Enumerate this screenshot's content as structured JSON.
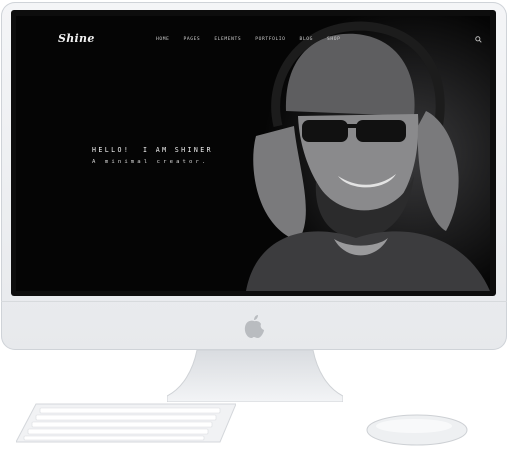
{
  "site": {
    "logo": "Shine",
    "nav": [
      "HOME",
      "PAGES",
      "ELEMENTS",
      "PORTFOLIO",
      "BLOG",
      "SHOP"
    ],
    "hero_title": "HELLO!  I AM SHINER",
    "hero_subtitle": "A minimal creator."
  },
  "icons": {
    "search": "search-icon",
    "apple": "apple-logo-icon"
  },
  "colors": {
    "screen_bg": "#050505",
    "frame": "#eceef1",
    "text": "#f1f1f1"
  }
}
